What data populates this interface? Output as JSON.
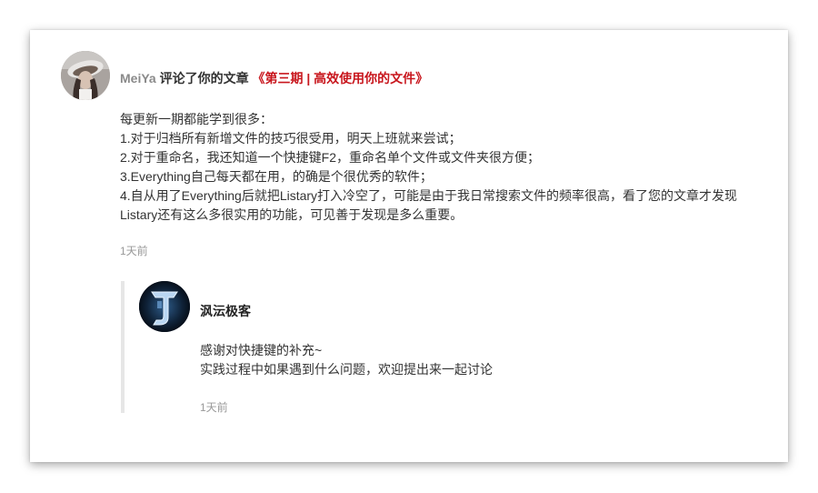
{
  "comment": {
    "author": "MeiYa",
    "action": " 评论了你的文章 ",
    "article_title": "《第三期 | 高效使用你的文件》",
    "lines": [
      "每更新一期都能学到很多：",
      "1.对于归档所有新增文件的技巧很受用，明天上班就来尝试；",
      "2.对于重命名，我还知道一个快捷键F2，重命名单个文件或文件夹很方便；",
      "3.Everything自己每天都在用，的确是个很优秀的软件；",
      "4.自从用了Everything后就把Listary打入冷空了，可能是由于我日常搜索文件的频率很高，看了您的文章才发现Listary还有这么多很实用的功能，可见善于发现是多么重要。"
    ],
    "time": "1天前"
  },
  "reply": {
    "author": "沨沄极客",
    "lines": [
      "感谢对快捷键的补充~",
      "实践过程中如果遇到什么问题，欢迎提出来一起讨论"
    ],
    "time": "1天前"
  },
  "colors": {
    "article_link": "#c8161d",
    "username": "#8a8a8a",
    "muted_time": "#999999",
    "reply_border": "#e6e6e6"
  }
}
